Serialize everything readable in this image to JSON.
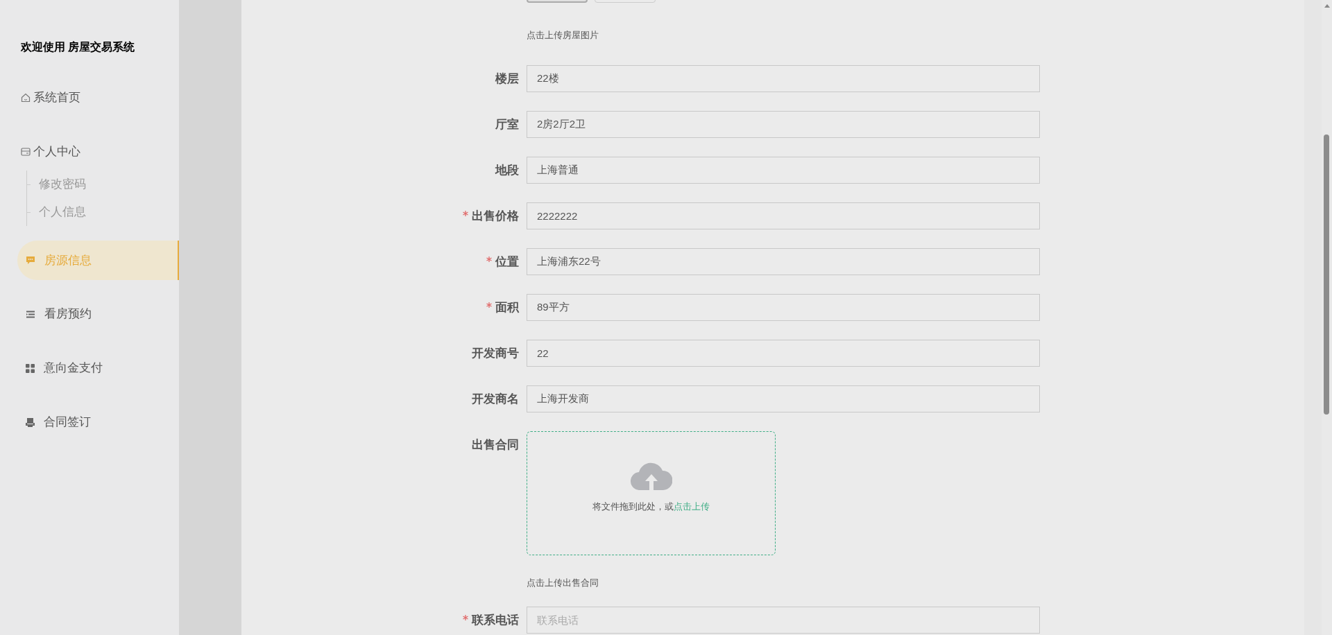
{
  "sidebar": {
    "title": "欢迎使用 房屋交易系统",
    "items": [
      {
        "label": "系统首页",
        "kind": "home",
        "selected": false
      },
      {
        "label": "个人中心",
        "kind": "card",
        "selected": false,
        "children": [
          {
            "label": "修改密码",
            "selected": false
          },
          {
            "label": "个人信息",
            "selected": false
          }
        ]
      },
      {
        "label": "房源信息",
        "kind": "chat",
        "selected": true
      },
      {
        "label": "看房预约",
        "kind": "list",
        "selected": false
      },
      {
        "label": "意向金支付",
        "kind": "grid",
        "selected": false
      },
      {
        "label": "合同签订",
        "kind": "printer",
        "selected": false
      }
    ]
  },
  "form": {
    "top_hint": "点击上传房屋图片",
    "fields": [
      {
        "kind": "input",
        "label": "楼层",
        "required": false,
        "value": "22楼"
      },
      {
        "kind": "input",
        "label": "厅室",
        "required": false,
        "value": "2房2厅2卫"
      },
      {
        "kind": "input",
        "label": "地段",
        "required": false,
        "value": "上海普通"
      },
      {
        "kind": "input",
        "label": "出售价格",
        "required": true,
        "value": "2222222"
      },
      {
        "kind": "input",
        "label": "位置",
        "required": true,
        "value": "上海浦东22号"
      },
      {
        "kind": "input",
        "label": "面积",
        "required": true,
        "value": "89平方"
      },
      {
        "kind": "input",
        "label": "开发商号",
        "required": false,
        "value": "22"
      },
      {
        "kind": "input",
        "label": "开发商名",
        "required": false,
        "value": "上海开发商"
      },
      {
        "kind": "upload",
        "label": "出售合同",
        "required": false,
        "drop_text": "将文件拖到此处，或",
        "link": "点击上传",
        "hint": "点击上传出售合同"
      },
      {
        "kind": "input",
        "label": "联系电话",
        "required": true,
        "placeholder": "联系电话"
      }
    ]
  }
}
